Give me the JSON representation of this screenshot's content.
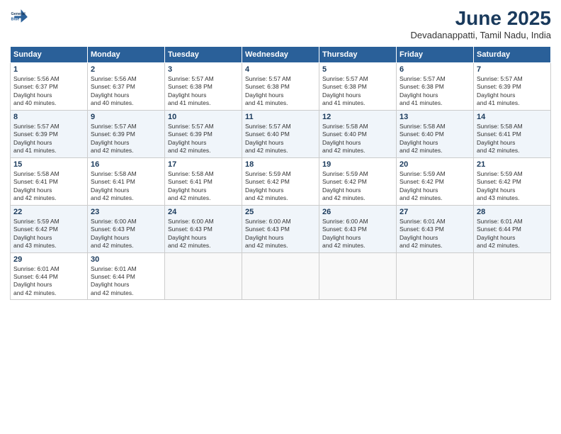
{
  "header": {
    "logo_line1": "General",
    "logo_line2": "Blue",
    "title": "June 2025",
    "location": "Devadanappatti, Tamil Nadu, India"
  },
  "weekdays": [
    "Sunday",
    "Monday",
    "Tuesday",
    "Wednesday",
    "Thursday",
    "Friday",
    "Saturday"
  ],
  "rows": [
    [
      {
        "day": "1",
        "rise": "5:56 AM",
        "set": "6:37 PM",
        "hours": "12 hours and 40 minutes."
      },
      {
        "day": "2",
        "rise": "5:56 AM",
        "set": "6:37 PM",
        "hours": "12 hours and 40 minutes."
      },
      {
        "day": "3",
        "rise": "5:57 AM",
        "set": "6:38 PM",
        "hours": "12 hours and 41 minutes."
      },
      {
        "day": "4",
        "rise": "5:57 AM",
        "set": "6:38 PM",
        "hours": "12 hours and 41 minutes."
      },
      {
        "day": "5",
        "rise": "5:57 AM",
        "set": "6:38 PM",
        "hours": "12 hours and 41 minutes."
      },
      {
        "day": "6",
        "rise": "5:57 AM",
        "set": "6:38 PM",
        "hours": "12 hours and 41 minutes."
      },
      {
        "day": "7",
        "rise": "5:57 AM",
        "set": "6:39 PM",
        "hours": "12 hours and 41 minutes."
      }
    ],
    [
      {
        "day": "8",
        "rise": "5:57 AM",
        "set": "6:39 PM",
        "hours": "12 hours and 41 minutes."
      },
      {
        "day": "9",
        "rise": "5:57 AM",
        "set": "6:39 PM",
        "hours": "12 hours and 42 minutes."
      },
      {
        "day": "10",
        "rise": "5:57 AM",
        "set": "6:39 PM",
        "hours": "12 hours and 42 minutes."
      },
      {
        "day": "11",
        "rise": "5:57 AM",
        "set": "6:40 PM",
        "hours": "12 hours and 42 minutes."
      },
      {
        "day": "12",
        "rise": "5:58 AM",
        "set": "6:40 PM",
        "hours": "12 hours and 42 minutes."
      },
      {
        "day": "13",
        "rise": "5:58 AM",
        "set": "6:40 PM",
        "hours": "12 hours and 42 minutes."
      },
      {
        "day": "14",
        "rise": "5:58 AM",
        "set": "6:41 PM",
        "hours": "12 hours and 42 minutes."
      }
    ],
    [
      {
        "day": "15",
        "rise": "5:58 AM",
        "set": "6:41 PM",
        "hours": "12 hours and 42 minutes."
      },
      {
        "day": "16",
        "rise": "5:58 AM",
        "set": "6:41 PM",
        "hours": "12 hours and 42 minutes."
      },
      {
        "day": "17",
        "rise": "5:58 AM",
        "set": "6:41 PM",
        "hours": "12 hours and 42 minutes."
      },
      {
        "day": "18",
        "rise": "5:59 AM",
        "set": "6:42 PM",
        "hours": "12 hours and 42 minutes."
      },
      {
        "day": "19",
        "rise": "5:59 AM",
        "set": "6:42 PM",
        "hours": "12 hours and 42 minutes."
      },
      {
        "day": "20",
        "rise": "5:59 AM",
        "set": "6:42 PM",
        "hours": "12 hours and 42 minutes."
      },
      {
        "day": "21",
        "rise": "5:59 AM",
        "set": "6:42 PM",
        "hours": "12 hours and 43 minutes."
      }
    ],
    [
      {
        "day": "22",
        "rise": "5:59 AM",
        "set": "6:42 PM",
        "hours": "12 hours and 43 minutes."
      },
      {
        "day": "23",
        "rise": "6:00 AM",
        "set": "6:43 PM",
        "hours": "12 hours and 42 minutes."
      },
      {
        "day": "24",
        "rise": "6:00 AM",
        "set": "6:43 PM",
        "hours": "12 hours and 42 minutes."
      },
      {
        "day": "25",
        "rise": "6:00 AM",
        "set": "6:43 PM",
        "hours": "12 hours and 42 minutes."
      },
      {
        "day": "26",
        "rise": "6:00 AM",
        "set": "6:43 PM",
        "hours": "12 hours and 42 minutes."
      },
      {
        "day": "27",
        "rise": "6:01 AM",
        "set": "6:43 PM",
        "hours": "12 hours and 42 minutes."
      },
      {
        "day": "28",
        "rise": "6:01 AM",
        "set": "6:44 PM",
        "hours": "12 hours and 42 minutes."
      }
    ],
    [
      {
        "day": "29",
        "rise": "6:01 AM",
        "set": "6:44 PM",
        "hours": "12 hours and 42 minutes."
      },
      {
        "day": "30",
        "rise": "6:01 AM",
        "set": "6:44 PM",
        "hours": "12 hours and 42 minutes."
      },
      null,
      null,
      null,
      null,
      null
    ]
  ]
}
